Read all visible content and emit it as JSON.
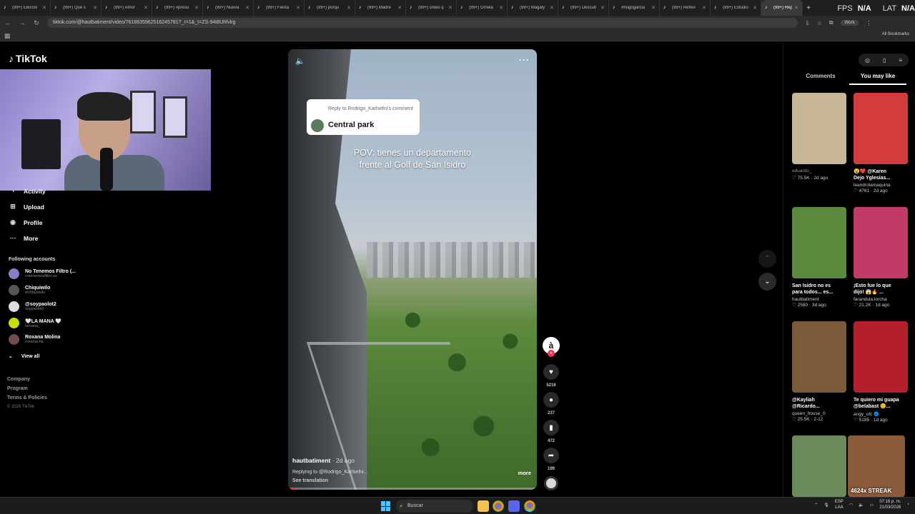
{
  "browser": {
    "tabs": [
      {
        "label": "(99+) Elecció"
      },
      {
        "label": "(99+) Qué s"
      },
      {
        "label": "(99+) Amor"
      },
      {
        "label": "(99+) #presu"
      },
      {
        "label": "(99+) Nueva"
      },
      {
        "label": "(99+) Fiesta"
      },
      {
        "label": "(99+) porqu"
      },
      {
        "label": "(99+) Madre"
      },
      {
        "label": "(99+) crees q"
      },
      {
        "label": "(99+) Ornela"
      },
      {
        "label": "(99+) Magaly"
      },
      {
        "label": "(99+) Descub"
      },
      {
        "label": "#hugogarcia"
      },
      {
        "label": "(99+) Reflex"
      },
      {
        "label": "(99+) Estudio"
      }
    ],
    "active_tab": "(99+) Rep",
    "url": "tiktok.com/@hautbatiment/video/7618835962516245781?_r=1&_t=ZS-94t8Uhfvlrg",
    "profile": "Work",
    "all_bookmarks": "All Bookmarks",
    "overlay": {
      "fps_label": "FPS",
      "fps_value": "N/A",
      "lat_label": "LAT",
      "lat_value": "N/A"
    }
  },
  "sidebar": {
    "logo": "TikTok",
    "nav": [
      {
        "label": "Activity",
        "icon": "bell-icon"
      },
      {
        "label": "Upload",
        "icon": "plus-square-icon"
      },
      {
        "label": "Profile",
        "icon": "user-icon"
      },
      {
        "label": "More",
        "icon": "dots-icon"
      }
    ],
    "following_title": "Following accounts",
    "accounts": [
      {
        "name": "No Tenemos Filtro (...",
        "handle": "notenemosfiltro.zs",
        "color": "#8a7ec8"
      },
      {
        "name": "Chiquiwilo",
        "handle": "elchiquiwilo",
        "color": "#555555"
      },
      {
        "name": "@soypaolot2",
        "handle": "soypaolot2",
        "color": "#dddddd"
      },
      {
        "name": "🤍LA MANA 🤍",
        "handle": "lamana_",
        "color": "#c6e000"
      },
      {
        "name": "Roxana Molina",
        "handle": "roxanacha",
        "color": "#6d4d4d"
      }
    ],
    "view_all": "View all",
    "footer": [
      "Company",
      "Program",
      "Terms & Policies"
    ],
    "copyright": "© 2026 TikTok"
  },
  "video": {
    "reply_to": "Reply to Rodrigo_Karlsefni's comment",
    "reply_text": "Central park",
    "overlay_text": "POV: tienes un departamento\nfrente al Golf de San Isidro",
    "author": "hautbatiment",
    "date": " · 2d ago",
    "replying": "Replying to @Rodrigo_Karlsefni...",
    "see_translation": "See translation",
    "more": "more",
    "progress": 0.03
  },
  "actions": {
    "creator_initial": "à",
    "likes": "5216",
    "comments": "237",
    "saves": "472",
    "shares": "199"
  },
  "right_panel": {
    "tab_comments": "Comments",
    "tab_you_may_like": "You may like",
    "cards": [
      {
        "caption": "",
        "author": "eduardo_",
        "stats": "♡ 75.5K · 2d ago",
        "color": "#c9b79a"
      },
      {
        "caption": "😮❤️ @Karen\nDejo Yglesias...",
        "author": "leandrolamaquina",
        "stats": "♡ 4761 · 2d ago",
        "color": "#d23c3c"
      },
      {
        "caption": "San Isidro no es\npara todos... es...",
        "author": "hautbatiment",
        "stats": "♡ 2580 · 3d ago",
        "color": "#5b8a3e"
      },
      {
        "caption": "¡Esto fue lo que\ndijo! 😱🔥 ...",
        "author": "farandula.lorcha",
        "stats": "♡ 21.2K · 1d ago",
        "color": "#c23a6a"
      },
      {
        "caption": "@Kayliah\n@Ricardo...",
        "author": "queen_house_0",
        "stats": "♡ 25.5K · 2-12",
        "color": "#7a5a3a"
      },
      {
        "caption": "Te quiero mi guapa\n@belabast 😊...",
        "author": "angy_ofc 🔵",
        "stats": "♡ 5185 · 1d ago",
        "color": "#b51f2c"
      },
      {
        "caption": "",
        "author": "",
        "stats": "",
        "color": "#6a8a5a"
      },
      {
        "caption": "",
        "author": "",
        "stats": "",
        "color": "#8a5a3a",
        "overlay": "4624x STREAK"
      }
    ]
  },
  "taskbar": {
    "search": "Buscar",
    "lang_top": "ESP",
    "lang_bottom": "LAA",
    "time": "07:16 p. m.",
    "date": "21/03/2026"
  }
}
